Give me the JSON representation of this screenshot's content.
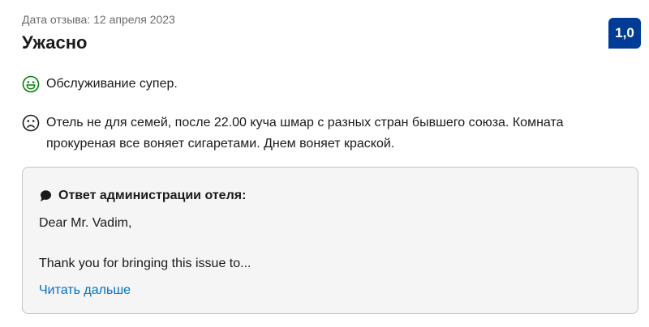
{
  "review": {
    "date_label": "Дата отзыва: 12 апреля 2023",
    "title": "Ужасно",
    "score": "1,0",
    "score_color": "#003b95",
    "positive": {
      "icon": "smile-icon",
      "icon_color": "#008009",
      "text": "Обслуживание супер."
    },
    "negative": {
      "icon": "frown-icon",
      "icon_color": "#1a1a1a",
      "text": "Отель не для семей, после 22.00 куча шмар с разных стран бывшего союза. Комната прокуреная все воняет сигаретами. Днем воняет краской."
    }
  },
  "reply": {
    "icon": "speech-bubble-icon",
    "title": "Ответ администрации отеля:",
    "greeting": "Dear Mr. Vadim,",
    "body": "Thank you for bringing this issue to...",
    "read_more": "Читать дальше",
    "link_color": "#0071c2"
  }
}
